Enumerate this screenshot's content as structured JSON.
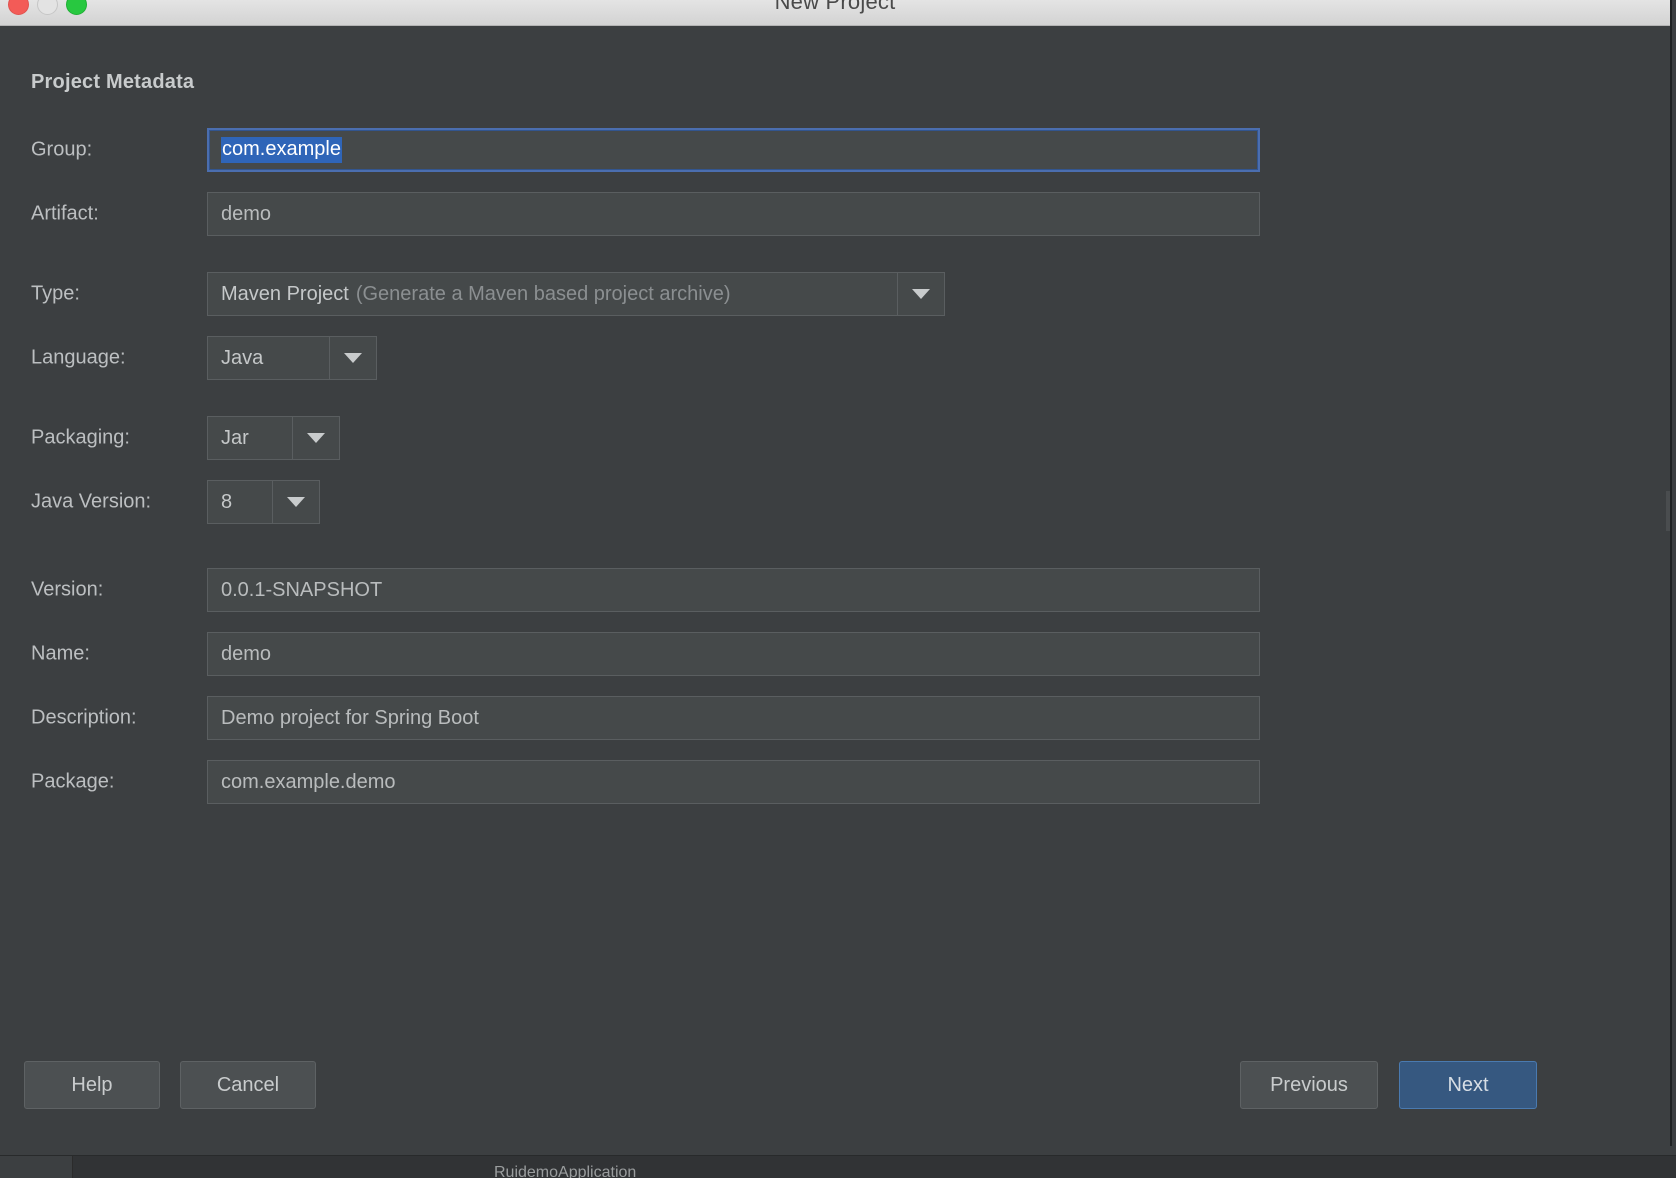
{
  "window": {
    "title": "New Project",
    "traffic_lights": {
      "close": "close-button",
      "minimize": "minimize-button",
      "maximize": "maximize-button"
    }
  },
  "section": {
    "title": "Project Metadata"
  },
  "fields": {
    "group": {
      "label": "Group:",
      "value": "com.example",
      "selected": true,
      "focused": true
    },
    "artifact": {
      "label": "Artifact:",
      "value": "demo"
    },
    "type": {
      "label": "Type:",
      "value": "Maven Project",
      "hint": "(Generate a Maven based project archive)"
    },
    "language": {
      "label": "Language:",
      "value": "Java"
    },
    "packaging": {
      "label": "Packaging:",
      "value": "Jar"
    },
    "java_version": {
      "label": "Java Version:",
      "value": "8"
    },
    "version": {
      "label": "Version:",
      "value": "0.0.1-SNAPSHOT"
    },
    "name": {
      "label": "Name:",
      "value": "demo"
    },
    "description": {
      "label": "Description:",
      "value": "Demo project for Spring Boot"
    },
    "package": {
      "label": "Package:",
      "value": "com.example.demo"
    }
  },
  "buttons": {
    "help": "Help",
    "cancel": "Cancel",
    "previous": "Previous",
    "next": "Next"
  },
  "background": {
    "status_label": "RuidemoApplication"
  },
  "colors": {
    "dialog_bg": "#3c3f41",
    "field_bg": "#45494a",
    "selection_blue": "#2f65b8",
    "focus_border": "#4b6eaf",
    "primary_button": "#365880",
    "titlebar": "#d9d9d9",
    "close_dot": "#f35b57",
    "min_dot": "#e3e3e3",
    "max_dot": "#28c840"
  }
}
